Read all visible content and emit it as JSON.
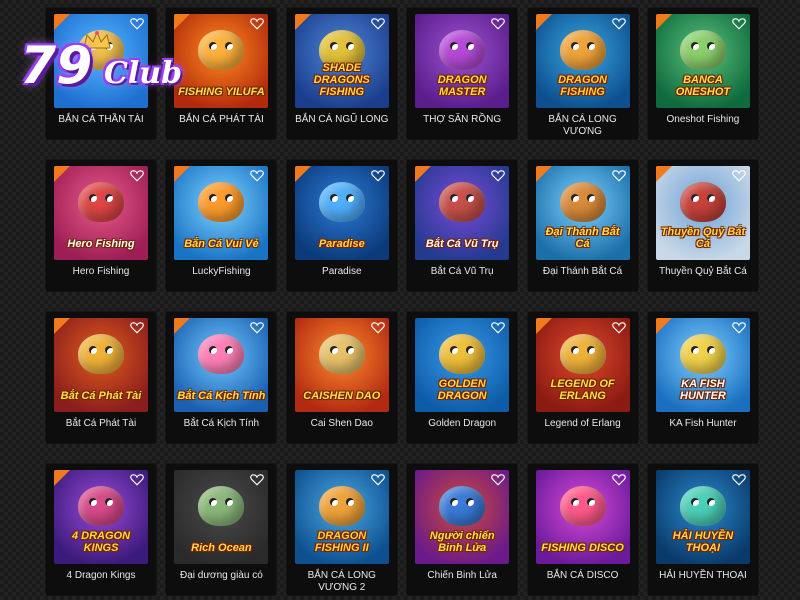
{
  "site": {
    "logo_number": "79",
    "logo_word": "Club"
  },
  "games": [
    {
      "label": "BẮN CÁ THẦN TÀI",
      "art": "",
      "hot": true,
      "bg": [
        "#1e6fd0",
        "#54b7ff"
      ],
      "creature": "#f2c14b",
      "title_color": "#ffd84a"
    },
    {
      "label": "BẮN CÁ PHÁT TÀI",
      "art": "FISHING YILUFA",
      "hot": true,
      "bg": [
        "#b22a0e",
        "#ff8a1c"
      ],
      "creature": "#ffb13b",
      "title_color": "#ffe04a"
    },
    {
      "label": "BẮN CÁ NGŨ LONG",
      "art": "SHADE DRAGONS FISHING",
      "hot": true,
      "bg": [
        "#1b3e8c",
        "#4f86d8"
      ],
      "creature": "#e3c23a",
      "title_color": "#ffd84a"
    },
    {
      "label": "THỢ SĂN RỒNG",
      "art": "DRAGON MASTER",
      "hot": false,
      "bg": [
        "#5a1d8c",
        "#9c52d0"
      ],
      "creature": "#b64ad8",
      "title_color": "#ffd84a"
    },
    {
      "label": "BẮN CÁ LONG VƯƠNG",
      "art": "DRAGON FISHING",
      "hot": true,
      "bg": [
        "#0d4f8f",
        "#38a6e0"
      ],
      "creature": "#f0a33a",
      "title_color": "#ffcf3a"
    },
    {
      "label": "Oneshot Fishing",
      "art": "BANCA ONESHOT",
      "hot": true,
      "bg": [
        "#0f6a3d",
        "#59c27c"
      ],
      "creature": "#8bd06b",
      "title_color": "#ffdf4a"
    },
    {
      "label": "Hero Fishing",
      "art": "Hero Fishing",
      "hot": true,
      "bg": [
        "#9c1e54",
        "#ea5a8a"
      ],
      "creature": "#e04646",
      "title_color": "#ffffff"
    },
    {
      "label": "LuckyFishing",
      "art": "Bắn Cá Vui Vẻ",
      "hot": true,
      "bg": [
        "#1a74c5",
        "#7fd3ff"
      ],
      "creature": "#ff9c2c",
      "title_color": "#ffe04a"
    },
    {
      "label": "Paradise",
      "art": "Paradise",
      "hot": true,
      "bg": [
        "#0b3a7a",
        "#2c7ad6"
      ],
      "creature": "#4fb0ff",
      "title_color": "#ffd84a"
    },
    {
      "label": "Bắt Cá Vũ Trụ",
      "art": "Bắt Cá Vũ Trụ",
      "hot": true,
      "bg": [
        "#233a8f",
        "#7a4ad8"
      ],
      "creature": "#c8504a",
      "title_color": "#ffffff"
    },
    {
      "label": "Đại Thánh Bắt Cá",
      "art": "Đại Thánh Bắt Cá",
      "hot": true,
      "bg": [
        "#1c6fa8",
        "#7ad0ff"
      ],
      "creature": "#d98a3a",
      "title_color": "#ffe04a"
    },
    {
      "label": "Thuyền Quỷ Bắt Cá",
      "art": "Thuyền Quỷ Bắt Cá",
      "hot": true,
      "bg": [
        "#c8d8e8",
        "#6fa2d6"
      ],
      "creature": "#c8423a",
      "title_color": "#ffd84a"
    },
    {
      "label": "Bắt Cá Phát Tài",
      "art": "Bắt Cá Phát Tài",
      "hot": true,
      "bg": [
        "#8a1e1e",
        "#e05a1c"
      ],
      "creature": "#f2b23a",
      "title_color": "#ffe04a"
    },
    {
      "label": "Bắt Cá Kịch Tính",
      "art": "Bắt Cá Kịch Tính",
      "hot": true,
      "bg": [
        "#1a5fb0",
        "#6fc8ff"
      ],
      "creature": "#ff7fb8",
      "title_color": "#ffe04a"
    },
    {
      "label": "Cai Shen Dao",
      "art": "CAISHEN DAO",
      "hot": false,
      "bg": [
        "#b22a12",
        "#ff8a2c"
      ],
      "creature": "#e8c26a",
      "title_color": "#ffe04a"
    },
    {
      "label": "Golden Dragon",
      "art": "GOLDEN DRAGON",
      "hot": false,
      "bg": [
        "#0d5ca8",
        "#3a9ae8"
      ],
      "creature": "#f0c03a",
      "title_color": "#ffd84a"
    },
    {
      "label": "Legend of Erlang",
      "art": "LEGEND OF ERLANG",
      "hot": true,
      "bg": [
        "#8a1a12",
        "#e0482c"
      ],
      "creature": "#f0b23a",
      "title_color": "#ffe04a"
    },
    {
      "label": "KA Fish Hunter",
      "art": "KA FISH HUNTER",
      "hot": true,
      "bg": [
        "#1a6fc0",
        "#7fd0ff"
      ],
      "creature": "#f0d24a",
      "title_color": "#ffffff"
    },
    {
      "label": "4 Dragon Kings",
      "art": "4 DRAGON KINGS",
      "hot": true,
      "bg": [
        "#3a1a7a",
        "#9a4ad8"
      ],
      "creature": "#d84a8a",
      "title_color": "#ffd84a"
    },
    {
      "label": "Đại dương giàu có",
      "art": "Rich Ocean",
      "hot": false,
      "bg": [
        "#2a2a2a",
        "#4a4a4a"
      ],
      "creature": "#8ab87a",
      "title_color": "#ffd84a"
    },
    {
      "label": "BẮN CÁ LONG VƯƠNG 2",
      "art": "DRAGON FISHING II",
      "hot": false,
      "bg": [
        "#0d4f8f",
        "#4aa8e0"
      ],
      "creature": "#f0a33a",
      "title_color": "#ffcf3a"
    },
    {
      "label": "Chiến Binh Lửa",
      "art": "Người chiến Binh Lửa",
      "hot": false,
      "bg": [
        "#6a1a8a",
        "#d04a3a"
      ],
      "creature": "#3a7ad8",
      "title_color": "#ffe04a"
    },
    {
      "label": "BẮN CÁ DISCO",
      "art": "FISHING DISCO",
      "hot": false,
      "bg": [
        "#6a1a9a",
        "#d84ad8"
      ],
      "creature": "#ff5a8a",
      "title_color": "#ffe04a"
    },
    {
      "label": "HẢI HUYỀN THOẠI",
      "art": "HẢI HUYỀN THOẠI",
      "hot": false,
      "bg": [
        "#0a3a6a",
        "#2a8ad0"
      ],
      "creature": "#4ad0b8",
      "title_color": "#ffd84a"
    }
  ]
}
